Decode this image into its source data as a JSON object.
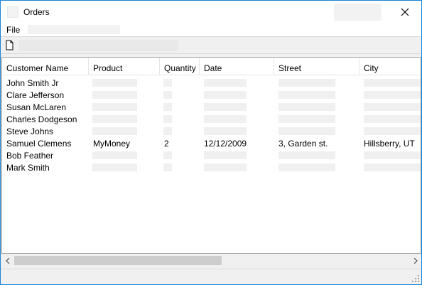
{
  "window": {
    "title": "Orders"
  },
  "menu": {
    "file": "File"
  },
  "grid": {
    "columns": [
      "Customer Name",
      "Product",
      "Quantity",
      "Date",
      "Street",
      "City"
    ],
    "rows": [
      [
        "John Smith Jr",
        "",
        "",
        "",
        "",
        ""
      ],
      [
        "Clare Jefferson",
        "",
        "",
        "",
        "",
        ""
      ],
      [
        "Susan McLaren",
        "",
        "",
        "",
        "",
        ""
      ],
      [
        "Charles Dodgeson",
        "",
        "",
        "",
        "",
        ""
      ],
      [
        "Steve Johns",
        "",
        "",
        "",
        "",
        ""
      ],
      [
        "Samuel Clemens",
        "MyMoney",
        "2",
        "12/12/2009",
        "3, Garden st.",
        "Hillsberry, UT"
      ],
      [
        "Bob Feather",
        "",
        "",
        "",
        "",
        ""
      ],
      [
        "Mark Smith",
        "",
        "",
        "",
        "",
        ""
      ]
    ]
  },
  "icons": {
    "new": "new-document-icon",
    "close": "close-icon",
    "scroll_left": "chevron-left-icon",
    "scroll_right": "chevron-right-icon",
    "grip": "resize-grip-icon"
  }
}
